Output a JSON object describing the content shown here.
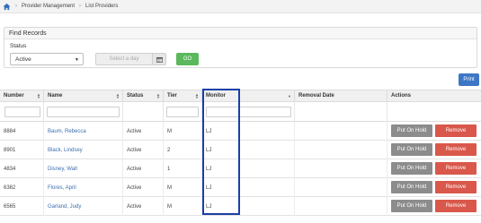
{
  "breadcrumb": {
    "home_icon": "home-icon",
    "items": [
      "Provider Management",
      "List Providers"
    ]
  },
  "find_panel": {
    "title": "Find Records",
    "status_label": "Status",
    "status_value": "Active",
    "date_placeholder": "Select a day",
    "go_label": "GO"
  },
  "print_label": "Print",
  "columns": [
    "Number",
    "Name",
    "Status",
    "Tier",
    "Monitor",
    "Removal Date",
    "Actions"
  ],
  "rows": [
    {
      "number": "8884",
      "name": "Baum, Rebecca",
      "status": "Active",
      "tier": "M",
      "monitor": "LJ",
      "removal_date": ""
    },
    {
      "number": "8901",
      "name": "Black, Lindsey",
      "status": "Active",
      "tier": "2",
      "monitor": "LJ",
      "removal_date": ""
    },
    {
      "number": "4834",
      "name": "Disney, Walt",
      "status": "Active",
      "tier": "1",
      "monitor": "LJ",
      "removal_date": ""
    },
    {
      "number": "6382",
      "name": "Flores, April",
      "status": "Active",
      "tier": "M",
      "monitor": "LJ",
      "removal_date": ""
    },
    {
      "number": "6565",
      "name": "Garland, Judy",
      "status": "Active",
      "tier": "M",
      "monitor": "LJ",
      "removal_date": ""
    }
  ],
  "actions": {
    "hold_label": "Put On Hold",
    "remove_label": "Remove"
  },
  "colors": {
    "go": "#5cb85c",
    "print": "#3d76c5",
    "hold": "#8c8c8c",
    "remove": "#d9584b",
    "link": "#3d6fb0",
    "highlight": "#1a3fa8"
  }
}
